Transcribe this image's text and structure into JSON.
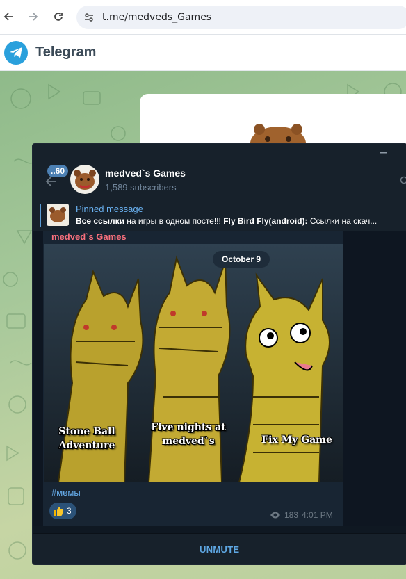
{
  "browser": {
    "url": "t.me/medveds_Games",
    "back_icon": "arrow-left-icon",
    "forward_icon": "arrow-right-icon",
    "reload_icon": "reload-icon",
    "site_settings_icon": "tune-icon"
  },
  "web_header": {
    "brand": "Telegram",
    "logo_icon": "telegram-plane-icon",
    "brand_color": "#2aa0dc"
  },
  "chat": {
    "title": "medved`s Games",
    "subtitle": "1,589 subscribers",
    "unread_badge": "..60",
    "pinned": {
      "label": "Pinned message",
      "text_parts": [
        "Все ссылки",
        " на игры в одном посте!!! ",
        "Fly Bird Fly(android):",
        " Ссылки на скач..."
      ]
    },
    "message": {
      "author": "medved`s Games",
      "author_color": "#f9707d",
      "date_pill": "October 9",
      "meme_captions": [
        "Stone Ball Adventure",
        "Five nights at medved`s",
        "Fix My Game"
      ],
      "hashtag": "#мемы",
      "reaction_count": "3",
      "reaction_icon": "thumbs-up-icon",
      "views": "183",
      "time": "4:01 PM"
    },
    "bottom_button": "UNMUTE"
  }
}
